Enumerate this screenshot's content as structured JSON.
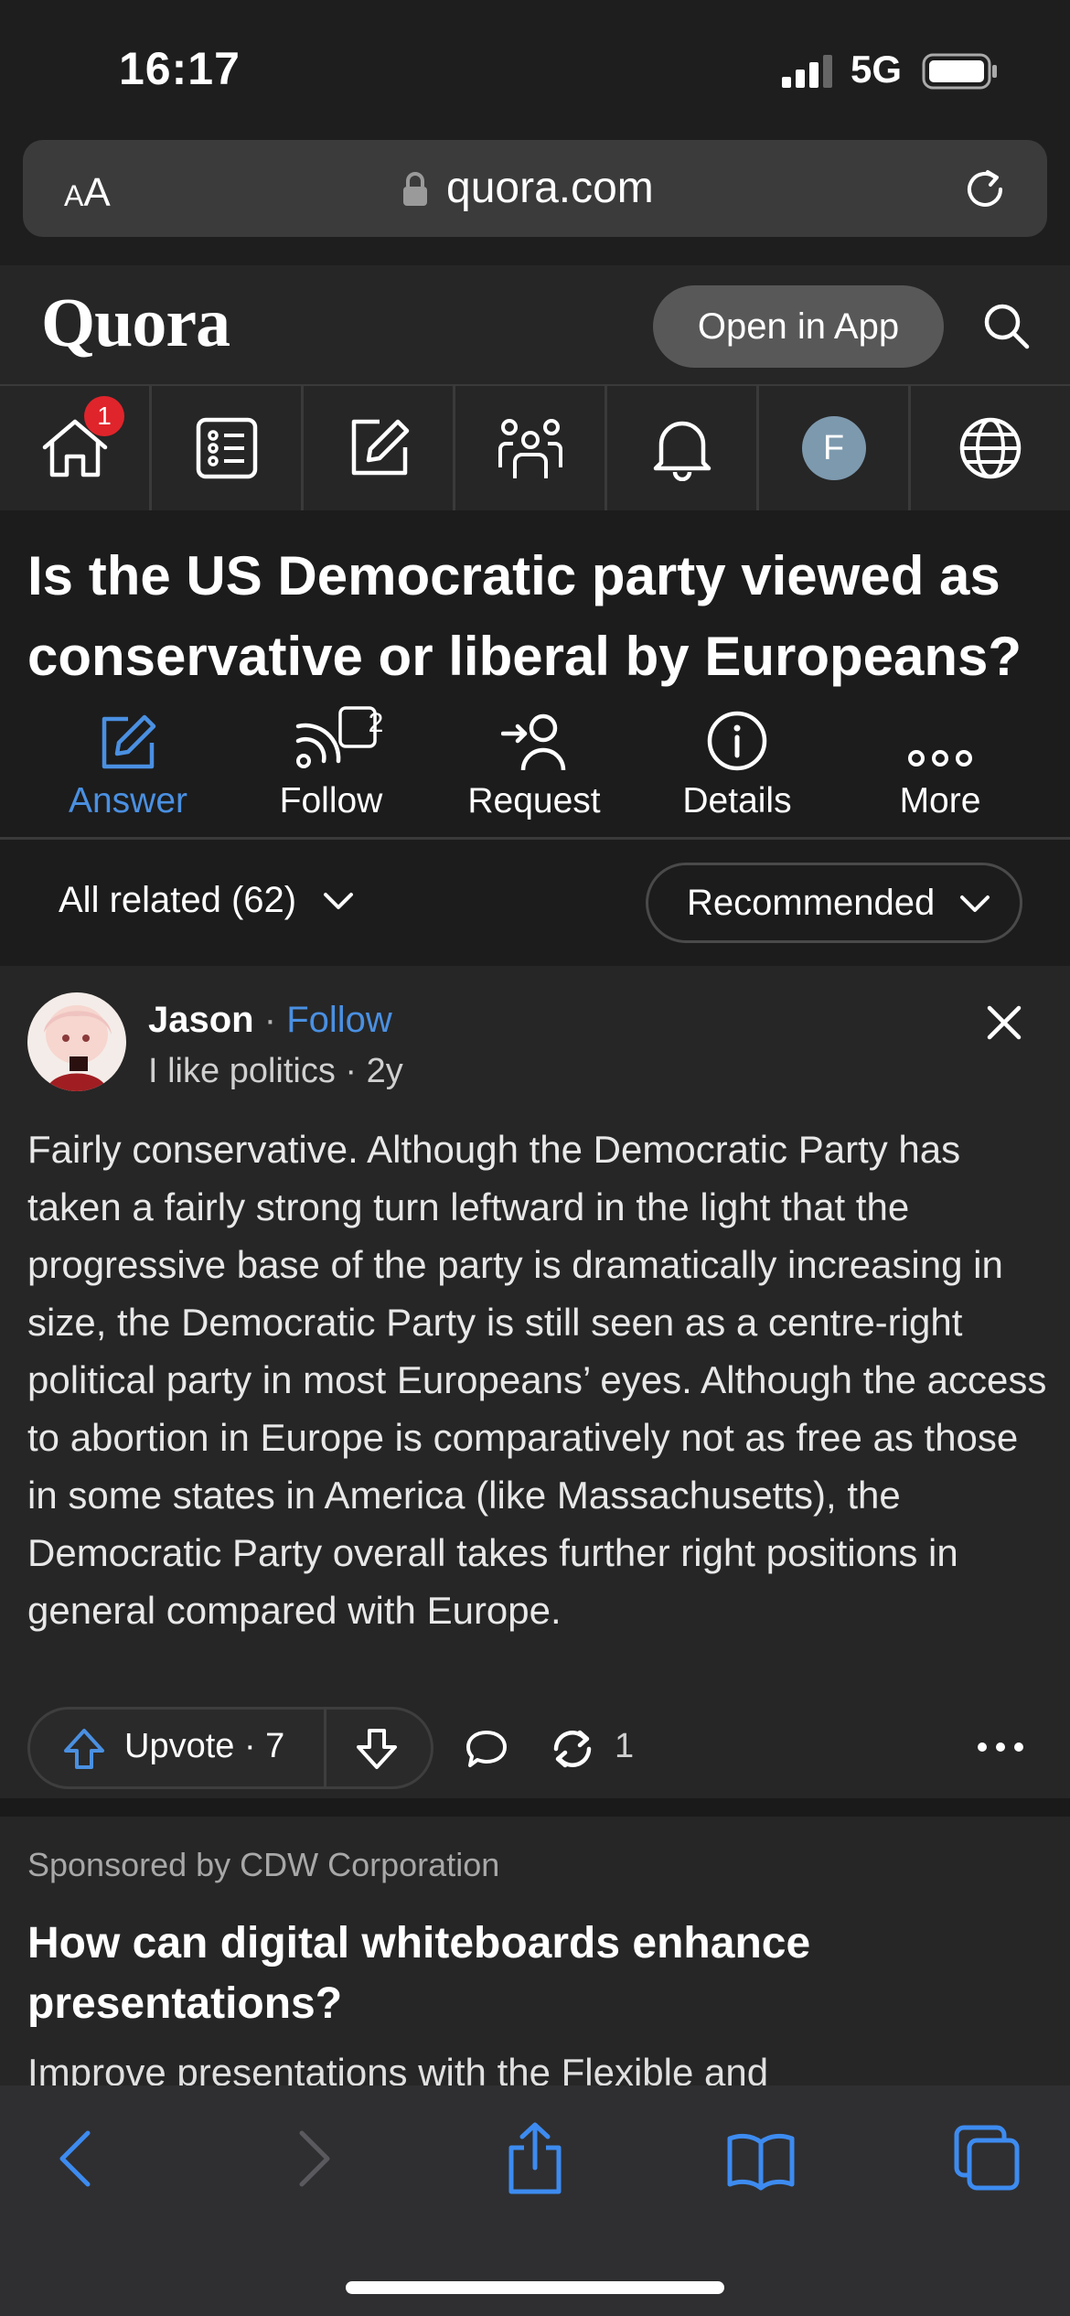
{
  "status_bar": {
    "time": "16:17",
    "network": "5G"
  },
  "url_bar": {
    "aa_small": "A",
    "aa_large": "A",
    "domain": "quora.com"
  },
  "header": {
    "logo": "Quora",
    "open_in_app": "Open in App"
  },
  "nav": {
    "home_badge": "1",
    "profile_initial": "F",
    "icons": [
      "home-icon",
      "answer-list-icon",
      "write-icon",
      "spaces-icon",
      "bell-icon",
      "profile-avatar",
      "globe-icon"
    ]
  },
  "question": {
    "title": "Is the US Democratic party viewed as conservative or liberal by Europeans?",
    "actions": [
      {
        "label": "Answer",
        "active": true
      },
      {
        "label": "Follow",
        "count": "2"
      },
      {
        "label": "Request"
      },
      {
        "label": "Details"
      },
      {
        "label": "More"
      }
    ]
  },
  "filters": {
    "all_related": "All related (62)",
    "sort": "Recommended"
  },
  "answer": {
    "author": "Jason",
    "sep": "·",
    "follow": "Follow",
    "credential": "I like politics · 2y",
    "text": "Fairly conservative. Although the Democratic Party has taken a fairly strong turn leftward in the light that the progressive base of the party is dramatically increasing in size, the Democratic Party is still seen as a centre-right political party in most Europeans’ eyes. Although the access to abortion in Europe is comparatively not as free as those in some states in America (like Massachusetts), the Democratic Party overall takes further right positions in general compared with Europe.",
    "upvote_label": "Upvote · 7",
    "share_count": "1"
  },
  "sponsored": {
    "label": "Sponsored by CDW Corporation",
    "title": "How can digital whiteboards enhance presentations?",
    "body": "Improve presentations with the Flexible and"
  },
  "colors": {
    "accent": "#4a90e2",
    "badge": "#e0242b",
    "background": "#262626"
  }
}
